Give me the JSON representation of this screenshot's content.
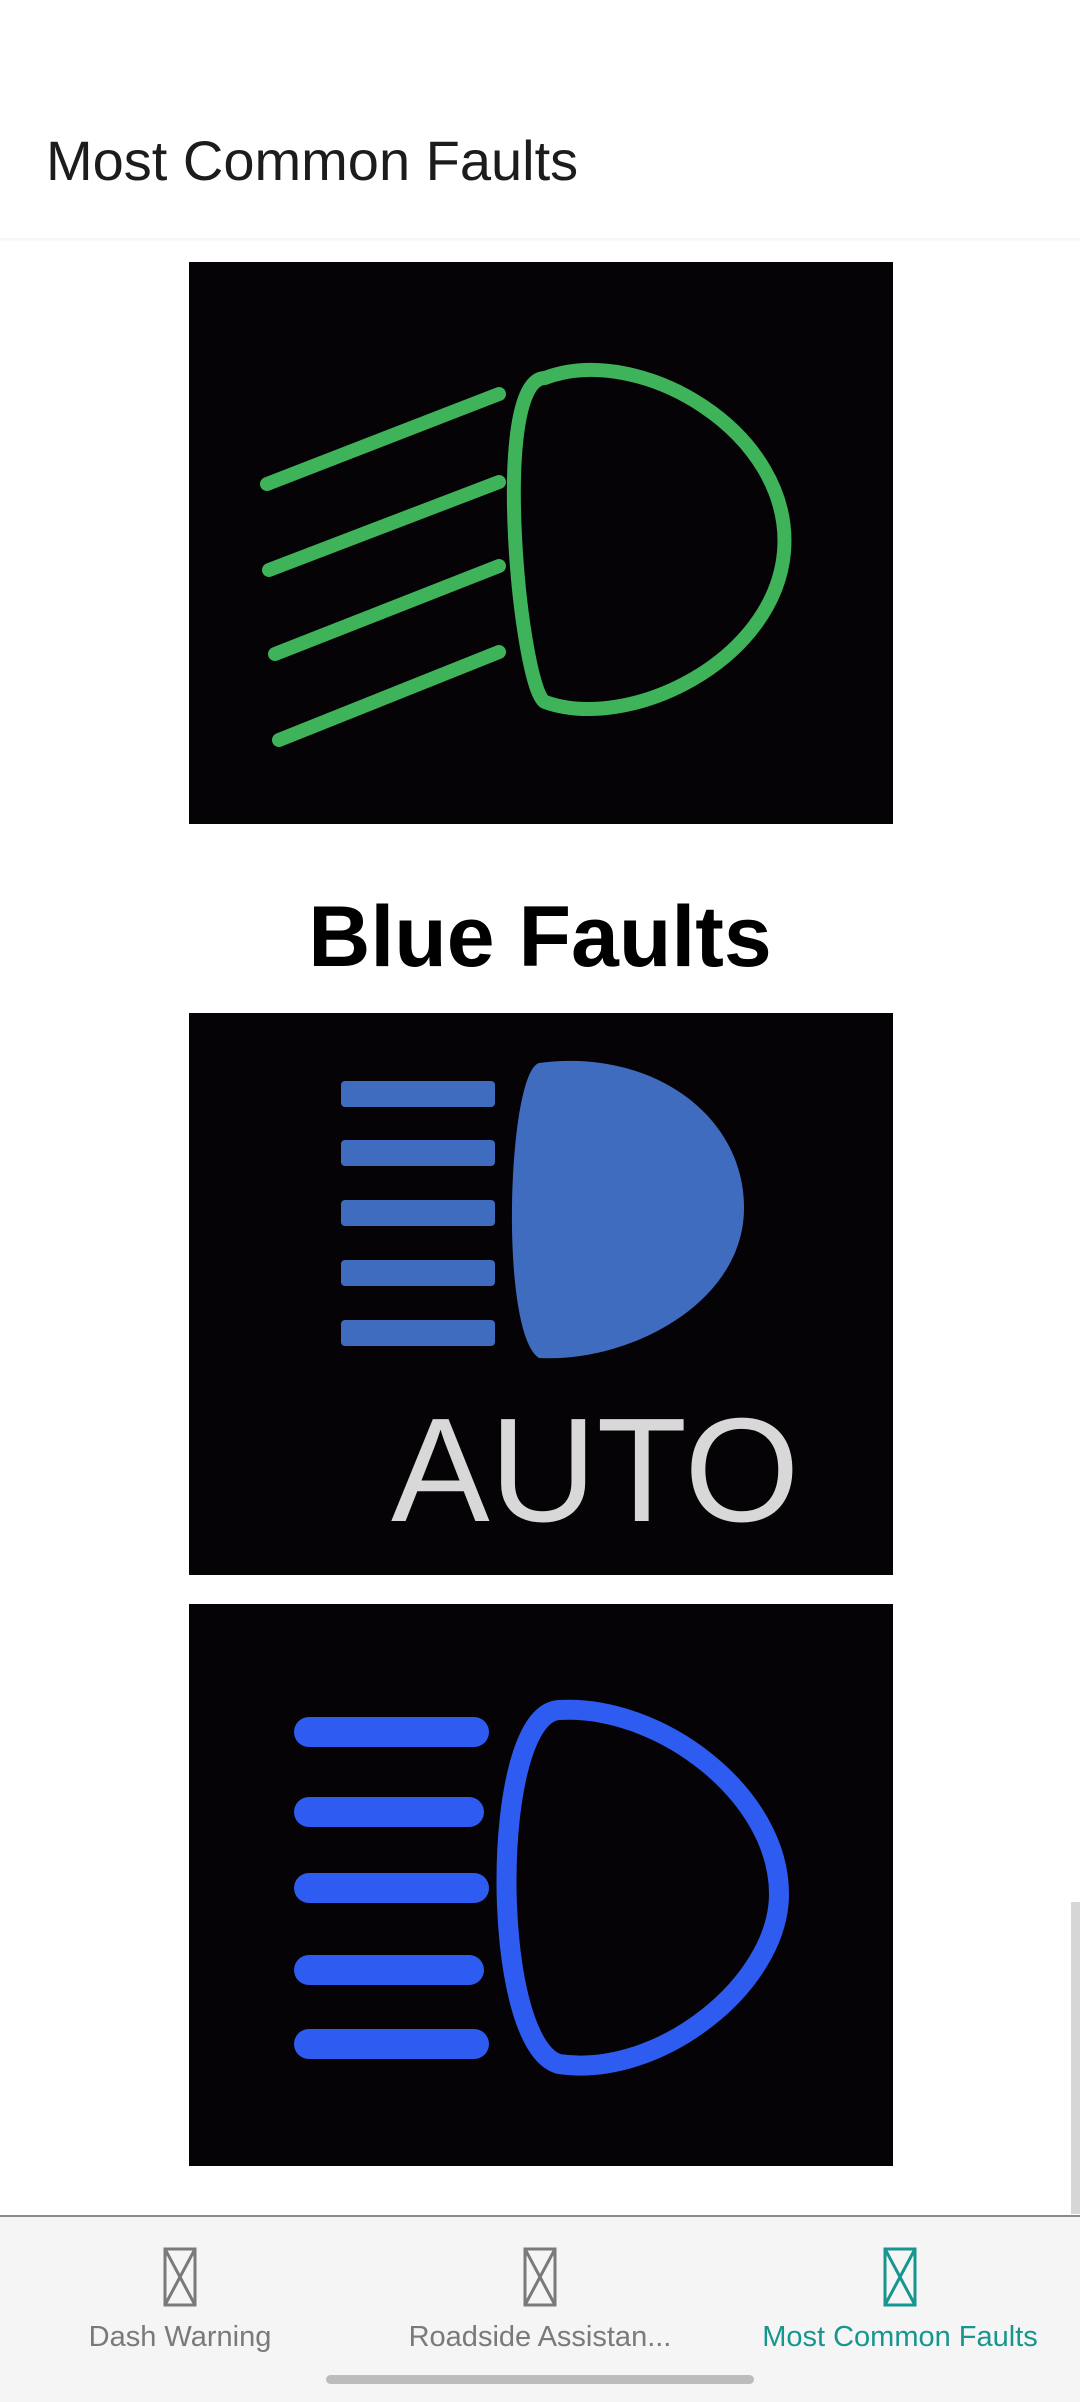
{
  "appbar": {
    "title": "Most Common Faults"
  },
  "sections": [
    {
      "heading": "Blue Faults"
    }
  ],
  "tiles": [
    {
      "icon": "green-headlight-icon",
      "color": "#3fb35a"
    },
    {
      "icon": "blue-auto-headlight-icon",
      "color": "#3f6cbf",
      "caption": "AUTO"
    },
    {
      "icon": "blue-high-beam-icon",
      "color": "#2f5cf0"
    }
  ],
  "bottom_nav": {
    "items": [
      {
        "label": "Dash Warning",
        "icon": "broken-image-icon",
        "active": false
      },
      {
        "label": "Roadside Assistan...",
        "icon": "broken-image-icon",
        "active": false
      },
      {
        "label": "Most Common Faults",
        "icon": "broken-image-icon",
        "active": true
      }
    ],
    "active_color": "#17968f"
  }
}
